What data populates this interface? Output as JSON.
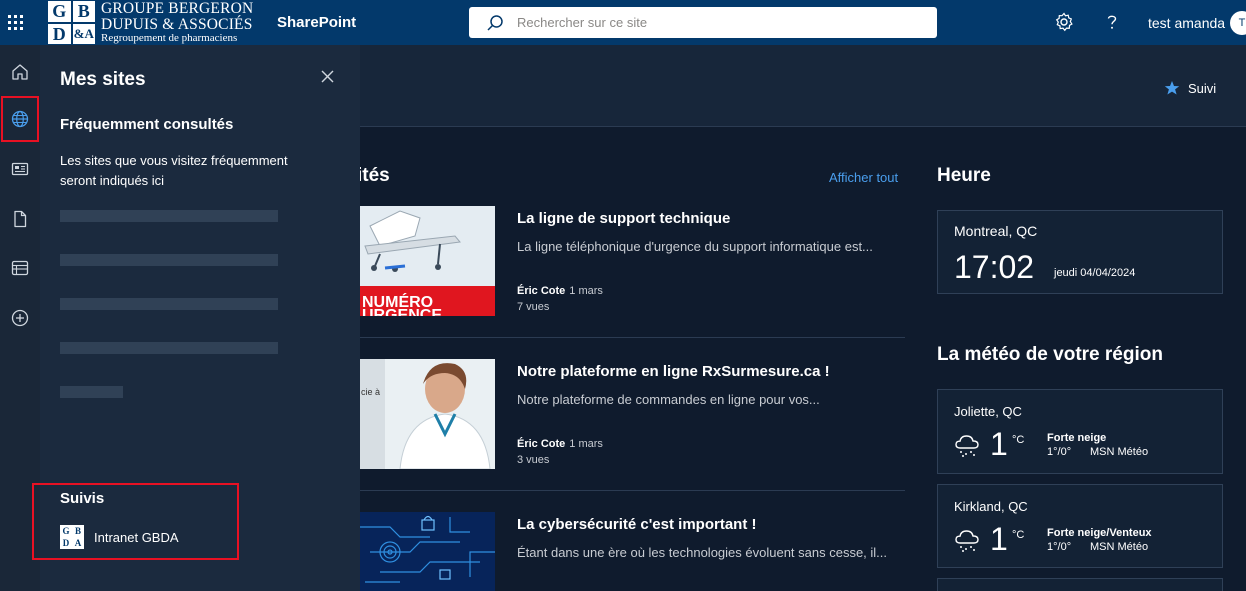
{
  "suitebar": {
    "logo": {
      "tl": "G",
      "tr": "B",
      "bl": "D",
      "br": "&A",
      "line1": "GROUPE BERGERON",
      "line2": "DUPUIS & ASSOCIÉS",
      "line3": "Regroupement de pharmaciens"
    },
    "app_name": "SharePoint",
    "search_placeholder": "Rechercher sur ce site",
    "user_name": "test amanda",
    "avatar_initial": "T"
  },
  "panel": {
    "title": "Mes sites",
    "frequent_title": "Fréquemment consultés",
    "frequent_desc": "Les sites que vous visitez fréquemment seront indiqués ici",
    "followed_title": "Suivis",
    "followed_items": [
      {
        "label": "Intranet GBDA",
        "logo": {
          "tl": "G",
          "tr": "B",
          "bl": "D",
          "br": "A"
        }
      }
    ]
  },
  "header": {
    "follow_label": "Suivi"
  },
  "news": {
    "section_title_partial": "ités",
    "show_all": "Afficher tout",
    "items": [
      {
        "title": "La ligne de support technique",
        "desc": "La ligne téléphonique d'urgence du support informatique est...",
        "author": "Éric Cote",
        "date": "1 mars",
        "views": "7 vues",
        "img_text1": "NUMÉRO",
        "img_text2": "URGENCE"
      },
      {
        "title": "Notre plateforme en ligne RxSurmesure.ca !",
        "desc": "Notre plateforme de commandes en ligne pour vos...",
        "author": "Éric Cote",
        "date": "1 mars",
        "views": "3 vues",
        "img_text1": "cie à"
      },
      {
        "title": "La cybersécurité c'est important !",
        "desc": "Étant dans une ère où les technologies évoluent sans cesse, il...",
        "author": "",
        "date": "",
        "views": ""
      }
    ]
  },
  "clock": {
    "title": "Heure",
    "city": "Montreal, QC",
    "time": "17:02",
    "date": "jeudi 04/04/2024"
  },
  "weather": {
    "title": "La météo de votre région",
    "items": [
      {
        "city": "Joliette, QC",
        "temp": "1",
        "unit": "°C",
        "condition": "Forte neige",
        "range": "1°/0°",
        "source": "MSN Météo"
      },
      {
        "city": "Kirkland, QC",
        "temp": "1",
        "unit": "°C",
        "condition": "Forte neige/Venteux",
        "range": "1°/0°",
        "source": "MSN Météo"
      }
    ]
  },
  "colors": {
    "suitebar": "#03396b",
    "accent_link": "#4a9eed",
    "highlight": "#e81123",
    "star": "#4a9eed"
  }
}
